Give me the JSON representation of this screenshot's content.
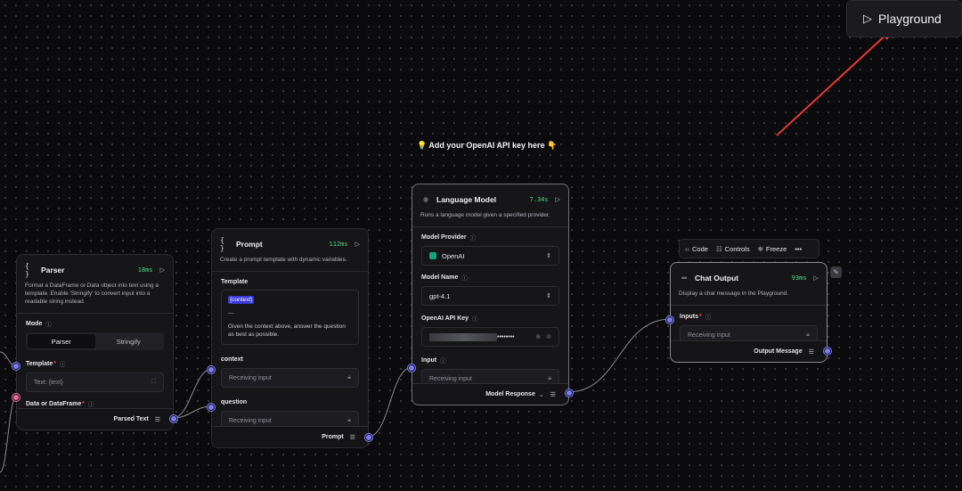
{
  "playground": {
    "label": "Playground",
    "icon": "play-icon"
  },
  "note": {
    "text": "💡 Add your OpenAI API key here 👇"
  },
  "toolbar": {
    "code": "Code",
    "controls": "Controls",
    "freeze": "Freeze",
    "more": "•••"
  },
  "parser": {
    "icon": "{ }",
    "title": "Parser",
    "time": "18ms",
    "desc": "Format a DataFrame or Data object into text using a template. Enable 'Stringify' to convert input into a readable string instead.",
    "mode_label": "Mode",
    "mode_options": [
      "Parser",
      "Stringify"
    ],
    "template_label": "Template",
    "template_value": "Text: {text}",
    "data_label": "Data or DataFrame",
    "output": "Parsed Text"
  },
  "prompt": {
    "icon": "{ }",
    "title": "Prompt",
    "time": "112ms",
    "desc": "Create a prompt template with dynamic variables.",
    "template_label": "Template",
    "template_var": "{context}",
    "template_sep": "---",
    "template_text": "Given the context above, answer the question as best as possible.",
    "context_label": "context",
    "context_placeholder": "Receiving input",
    "question_label": "question",
    "question_placeholder": "Receiving input",
    "output": "Prompt"
  },
  "llm": {
    "title": "Language Model",
    "time": "7.34s",
    "desc": "Runs a language model given a specified provider.",
    "provider_label": "Model Provider",
    "provider_value": "OpenAI",
    "model_label": "Model Name",
    "model_value": "gpt-4.1",
    "key_label": "OpenAI API Key",
    "key_value": "••••••••",
    "input_label": "Input",
    "input_placeholder": "Receiving input",
    "output": "Model Response"
  },
  "chat": {
    "title": "Chat Output",
    "time": "93ms",
    "desc": "Display a chat message in the Playground.",
    "inputs_label": "Inputs",
    "inputs_placeholder": "Receiving input",
    "output": "Output Message"
  },
  "colors": {
    "accent": "#7b7bf5",
    "success": "#4ade80",
    "danger": "#ef4444",
    "arrow": "#e53935"
  }
}
